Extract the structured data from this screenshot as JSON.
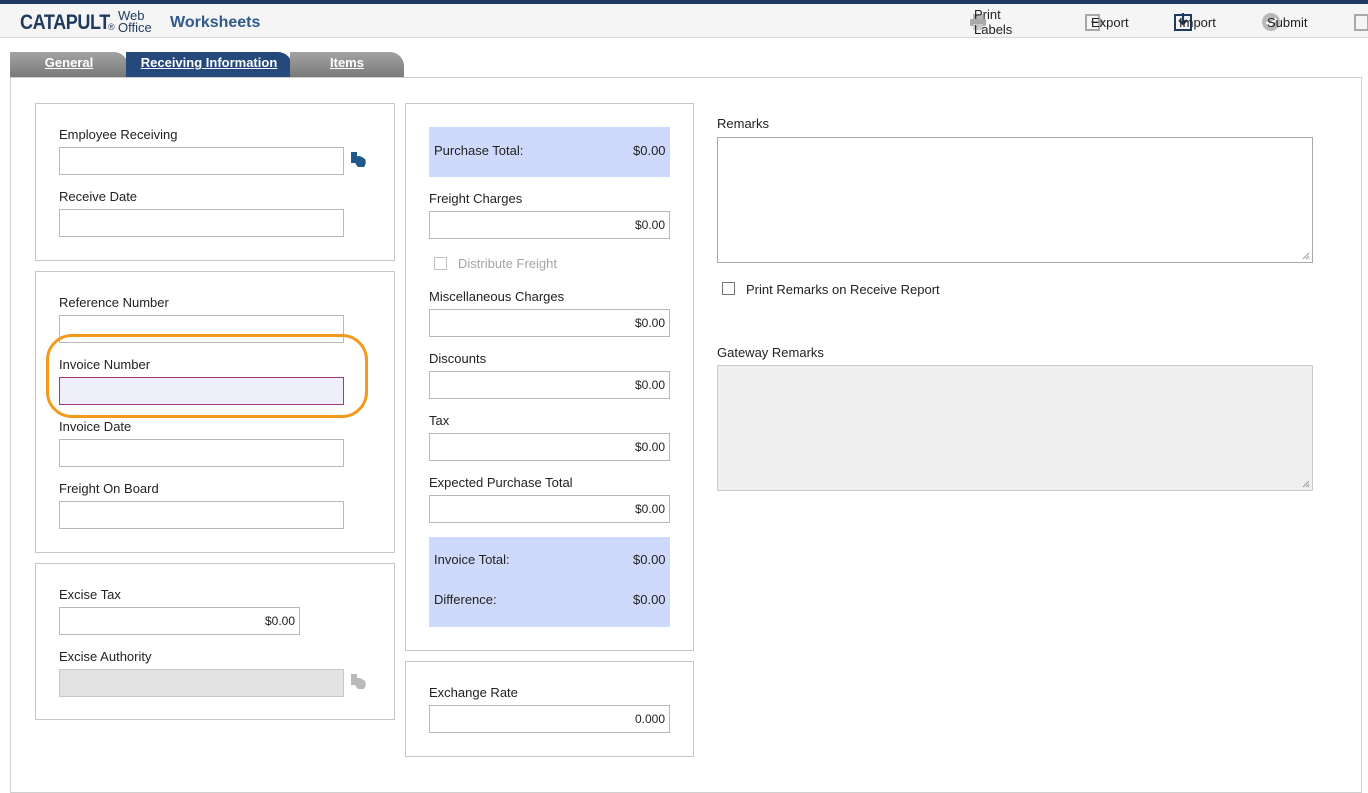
{
  "app": {
    "logo_main": "CATAPULT",
    "logo_reg": "®",
    "logo_web": "Web",
    "logo_office": "Office",
    "module_title": "Worksheets"
  },
  "toolbar": {
    "print_labels": "Print Labels",
    "export": "Export",
    "import": "Import",
    "submit": "Submit"
  },
  "tabs": [
    {
      "label": "General",
      "active": false
    },
    {
      "label": "Receiving Information",
      "active": true
    },
    {
      "label": "Items",
      "active": false
    }
  ],
  "employee_panel": {
    "employee_receiving_label": "Employee Receiving",
    "employee_receiving_value": "",
    "receive_date_label": "Receive Date",
    "receive_date_value": ""
  },
  "reference_panel": {
    "reference_number_label": "Reference Number",
    "reference_number_value": "",
    "invoice_number_label": "Invoice Number",
    "invoice_number_value": "",
    "invoice_date_label": "Invoice Date",
    "invoice_date_value": "",
    "freight_on_board_label": "Freight On Board",
    "freight_on_board_value": ""
  },
  "excise_panel": {
    "excise_tax_label": "Excise Tax",
    "excise_tax_value": "$0.00",
    "excise_authority_label": "Excise Authority",
    "excise_authority_value": ""
  },
  "totals_panel": {
    "purchase_total_label": "Purchase Total:",
    "purchase_total_value": "$0.00",
    "freight_charges_label": "Freight Charges",
    "freight_charges_value": "$0.00",
    "distribute_freight_label": "Distribute Freight",
    "misc_charges_label": "Miscellaneous Charges",
    "misc_charges_value": "$0.00",
    "discounts_label": "Discounts",
    "discounts_value": "$0.00",
    "tax_label": "Tax",
    "tax_value": "$0.00",
    "expected_total_label": "Expected Purchase Total",
    "expected_total_value": "$0.00",
    "invoice_total_label": "Invoice Total:",
    "invoice_total_value": "$0.00",
    "difference_label": "Difference:",
    "difference_value": "$0.00"
  },
  "exchange_panel": {
    "exchange_rate_label": "Exchange Rate",
    "exchange_rate_value": "0.000"
  },
  "remarks": {
    "remarks_label": "Remarks",
    "remarks_value": "",
    "print_remarks_label": "Print Remarks on Receive Report",
    "gateway_remarks_label": "Gateway Remarks",
    "gateway_remarks_value": ""
  },
  "colors": {
    "brand_navy": "#1f3a5f",
    "active_tab": "#24497a",
    "totals_bg": "#cfd9fb",
    "highlight": "#f39a1c"
  }
}
